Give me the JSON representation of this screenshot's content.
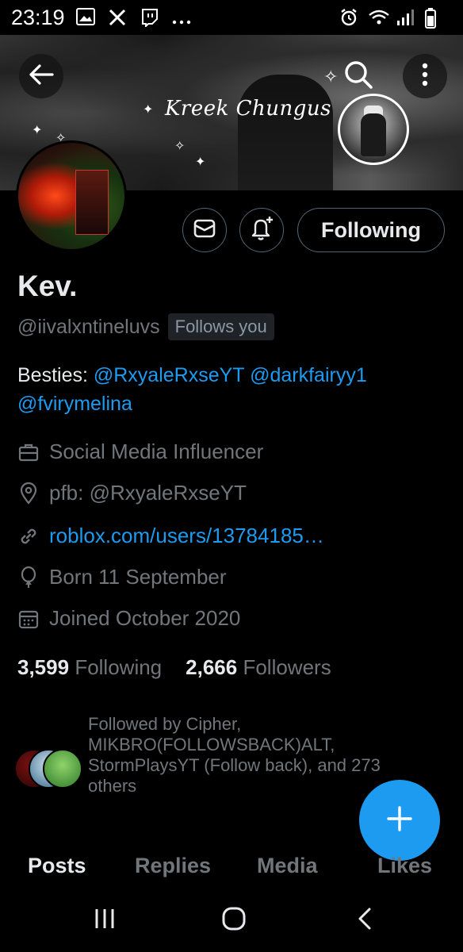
{
  "status_bar": {
    "time": "23:19",
    "icons_left": [
      "gallery-icon",
      "x-icon",
      "twitch-icon",
      "more-dots-icon"
    ],
    "icons_right": [
      "alarm-icon",
      "wifi-icon",
      "signal-icon",
      "battery-icon"
    ]
  },
  "banner": {
    "title": "Kreek Chungus"
  },
  "header_actions": {
    "back": "back-arrow-icon",
    "search": "search-icon",
    "more": "more-vertical-icon"
  },
  "profile": {
    "display_name": "Kev.",
    "handle": "@iivalxntineluvs",
    "follows_you": "Follows you",
    "bio_prefix": "Besties: ",
    "bio_mentions": [
      "@RxyaleRxseYT",
      "@darkfairyy1",
      "@fvirymelina"
    ],
    "category": "Social Media Influencer",
    "location": "pfb: @RxyaleRxseYT",
    "website": "roblox.com/users/13784185…",
    "birthday": "Born 11 September",
    "joined": "Joined October 2020"
  },
  "actions": {
    "following_label": "Following"
  },
  "stats": {
    "following_count": "3,599",
    "following_label": "Following",
    "followers_count": "2,666",
    "followers_label": "Followers"
  },
  "followed_by": {
    "text": "Followed by Cipher,\nMIKBRO(FOLLOWSBACK)ALT,\nStormPlaysYT (Follow back), and 273\nothers"
  },
  "tabs": [
    "Posts",
    "Replies",
    "Media",
    "Likes"
  ],
  "active_tab": "Posts",
  "colors": {
    "accent": "#1d9bf0",
    "background": "#000000",
    "secondary_text": "#71767b"
  },
  "nav": [
    "recents-icon",
    "home-icon",
    "back-icon"
  ]
}
